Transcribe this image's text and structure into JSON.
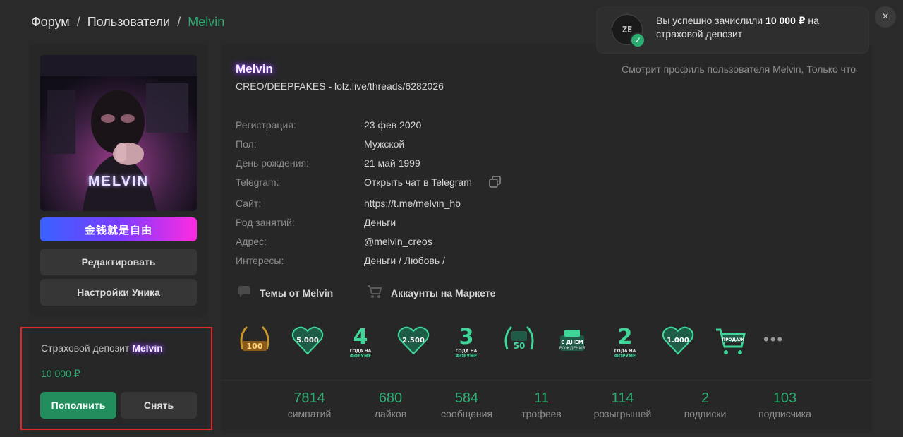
{
  "breadcrumb": {
    "items": [
      "Форум",
      "Пользователи"
    ],
    "current": "Melvin",
    "separator": "/"
  },
  "sidebar": {
    "avatar_text": "MELVIN",
    "banner": "金钱就是自由",
    "edit_label": "Редактировать",
    "settings_label": "Настройки Уника"
  },
  "deposit": {
    "title": "Страховой депозит",
    "nick": "Melvin",
    "amount": "10 000 ₽",
    "topup_label": "Пополнить",
    "withdraw_label": "Снять"
  },
  "profile": {
    "username": "Melvin",
    "title": "CREO/DEEPFAKES - lolz.live/threads/6282026",
    "viewing": "Смотрит профиль пользователя Melvin, Только что",
    "info": [
      {
        "label": "Регистрация:",
        "value": "23 фев 2020"
      },
      {
        "label": "Пол:",
        "value": "Мужской"
      },
      {
        "label": "День рождения:",
        "value": "21 май 1999"
      },
      {
        "label": "Telegram:",
        "value": "Открыть чат в Telegram"
      },
      {
        "label": "Сайт:",
        "value": "https://t.me/melvin_hb"
      },
      {
        "label": "Род занятий:",
        "value": "Деньги"
      },
      {
        "label": "Адрес:",
        "value": "@melvin_creos"
      },
      {
        "label": "Интересы:",
        "value": "Деньги / Любовь /"
      }
    ],
    "links": {
      "threads": "Темы от Melvin",
      "market": "Аккаунты на Маркете"
    },
    "trophies": [
      {
        "name": "trophy-100-draws",
        "text": "100",
        "sub": "РОЗЫГРЫШЕЙ"
      },
      {
        "name": "trophy-5000-likes",
        "text": "5.000",
        "sub": ""
      },
      {
        "name": "trophy-4-years",
        "text": "4",
        "sub": "ГОДА НА ФОРУМЕ"
      },
      {
        "name": "trophy-2500-likes",
        "text": "2.500",
        "sub": ""
      },
      {
        "name": "trophy-3-years",
        "text": "3",
        "sub": "ГОДА НА ФОРУМЕ"
      },
      {
        "name": "trophy-50-draws",
        "text": "50",
        "sub": "РОЗЫГРЫШЕЙ"
      },
      {
        "name": "trophy-birthday",
        "text": "С ДНЕМ",
        "sub": "РОЖДЕНИЯ"
      },
      {
        "name": "trophy-2-years",
        "text": "2",
        "sub": "ГОДА НА ФОРУМЕ"
      },
      {
        "name": "trophy-1000-likes",
        "text": "1.000",
        "sub": ""
      },
      {
        "name": "trophy-market-sales",
        "text": "ПРОДАЖ",
        "sub": ""
      }
    ],
    "more_label": "•••",
    "stats": [
      {
        "value": "7814",
        "label": "симпатий"
      },
      {
        "value": "680",
        "label": "лайков"
      },
      {
        "value": "584",
        "label": "сообщения"
      },
      {
        "value": "11",
        "label": "трофеев"
      },
      {
        "value": "114",
        "label": "розыгрышей"
      },
      {
        "value": "2",
        "label": "подписки"
      },
      {
        "value": "103",
        "label": "подписчика"
      }
    ]
  },
  "toast": {
    "avatar_text": "ZE",
    "text_before": "Вы успешно зачислили ",
    "amount": "10 000 ₽",
    "text_after": " на страховой депозит",
    "close_icon": "×"
  },
  "colors": {
    "accent": "#2bad72",
    "background": "#2a2a2a",
    "card": "#272727",
    "highlight_frame": "#e0262b",
    "nick_glow": "#9b4dff"
  }
}
